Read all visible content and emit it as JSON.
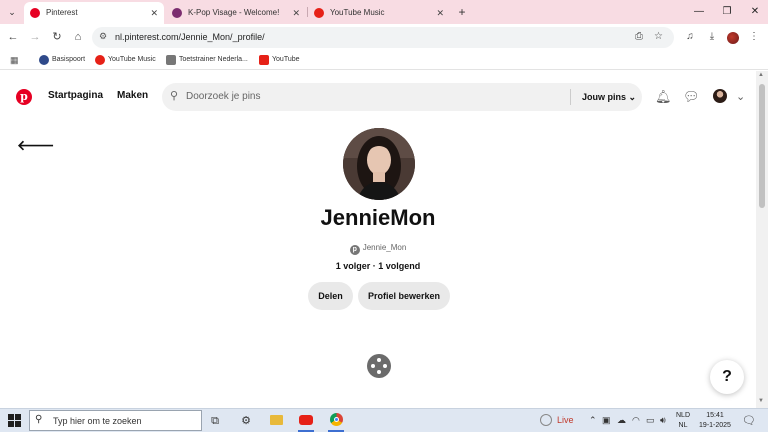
{
  "browser": {
    "tabs": [
      {
        "title": "Pinterest",
        "active": true,
        "icon_color": "#e60023"
      },
      {
        "title": "K-Pop Visage - Welcome!",
        "active": false,
        "icon_color": "#7b2d6f"
      },
      {
        "title": "YouTube Music",
        "active": false,
        "icon_color": "#e62117"
      }
    ],
    "url": "nl.pinterest.com/Jennie_Mon/_profile/",
    "bookmarks": [
      {
        "label": "Basispoort",
        "icon_color": "#2f4a8a"
      },
      {
        "label": "YouTube Music",
        "icon_color": "#e62117"
      },
      {
        "label": "Toetstrainer Nederla...",
        "icon_color": "#777777"
      },
      {
        "label": "YouTube",
        "icon_color": "#e62117"
      }
    ]
  },
  "pinterest": {
    "nav": {
      "home": "Startpagina",
      "create": "Maken"
    },
    "search": {
      "placeholder": "Doorzoek je pins",
      "scope": "Jouw pins"
    },
    "profile": {
      "name": "JennieMon",
      "handle": "Jennie_Mon",
      "followers": "1 volger",
      "following": "1 volgend",
      "follow_separator": "·",
      "share_button": "Delen",
      "edit_button": "Profiel bewerken"
    },
    "help_label": "?",
    "brand_color": "#e60023"
  },
  "taskbar": {
    "search_placeholder": "Typ hier om te zoeken",
    "live_label": "Live",
    "language_top": "NLD",
    "language_bottom": "NL",
    "time": "15:41",
    "date": "19-1-2025"
  }
}
